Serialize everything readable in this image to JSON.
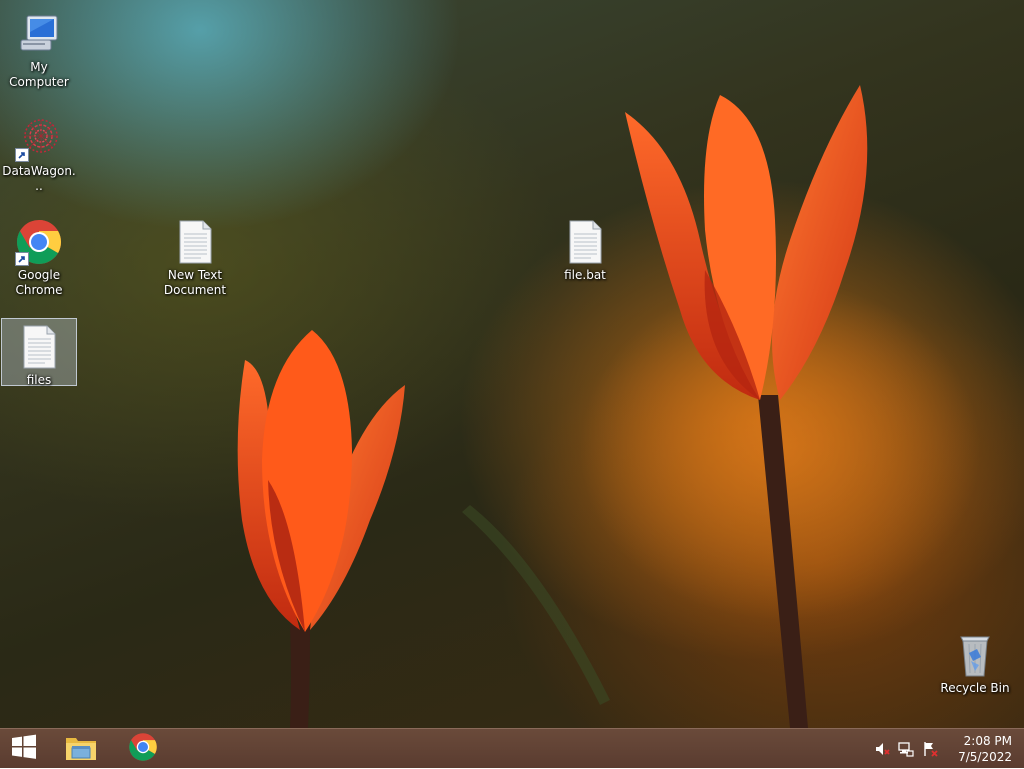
{
  "desktop": {
    "icons": {
      "my_computer": {
        "label": "My Computer",
        "icon": "computer-icon"
      },
      "datawagon": {
        "label": "DataWagon...",
        "icon": "datawagon-icon"
      },
      "chrome": {
        "label": "Google Chrome",
        "icon": "chrome-icon"
      },
      "new_text": {
        "label": "New Text Document",
        "icon": "text-document-icon"
      },
      "file_bat": {
        "label": "file.bat",
        "icon": "batch-file-icon"
      },
      "files": {
        "label": "files",
        "icon": "text-document-icon",
        "selected": true
      },
      "recycle_bin": {
        "label": "Recycle Bin",
        "icon": "recycle-bin-icon"
      }
    },
    "wallpaper": "orange tulips on dark green-brown background"
  },
  "taskbar": {
    "start": {
      "icon": "windows-logo-icon"
    },
    "pinned": [
      {
        "name": "File Explorer",
        "icon": "file-explorer-icon"
      },
      {
        "name": "Google Chrome",
        "icon": "chrome-icon"
      }
    ],
    "tray": [
      {
        "icon": "volume-muted-icon"
      },
      {
        "icon": "network-icon"
      },
      {
        "icon": "action-center-flag-icon"
      }
    ],
    "clock": {
      "time": "2:08 PM",
      "date": "7/5/2022"
    }
  },
  "colors": {
    "taskbar": "#5a3c30",
    "tulip_orange": "#ff5a1a",
    "selection": "#c8d7eb"
  }
}
